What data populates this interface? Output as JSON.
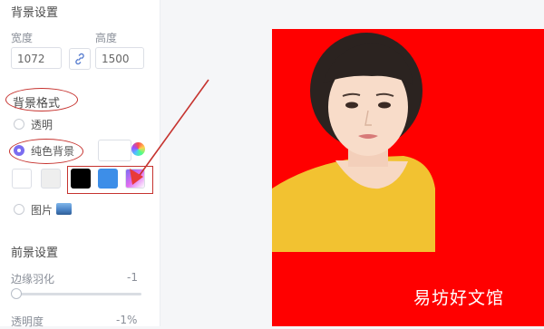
{
  "background_settings": {
    "title": "背景设置",
    "width_label": "宽度",
    "width_value": "1072",
    "height_label": "高度",
    "height_value": "1500"
  },
  "background_format": {
    "title": "背景格式",
    "option_transparent": "透明",
    "option_solid": "纯色背景",
    "option_image": "图片",
    "selected": "纯色背景",
    "swatches": [
      "#ffffff",
      "#eeeeee",
      "#000000",
      "#3d8ee8",
      "gradient"
    ]
  },
  "foreground_settings": {
    "title": "前景设置",
    "feather_label": "边缘羽化",
    "feather_value": "-1",
    "opacity_label": "透明度",
    "opacity_value": "-1%"
  },
  "preview": {
    "background_color": "#ff0000",
    "watermark": "易坊好文馆"
  },
  "annotation_color": "#c6332f"
}
